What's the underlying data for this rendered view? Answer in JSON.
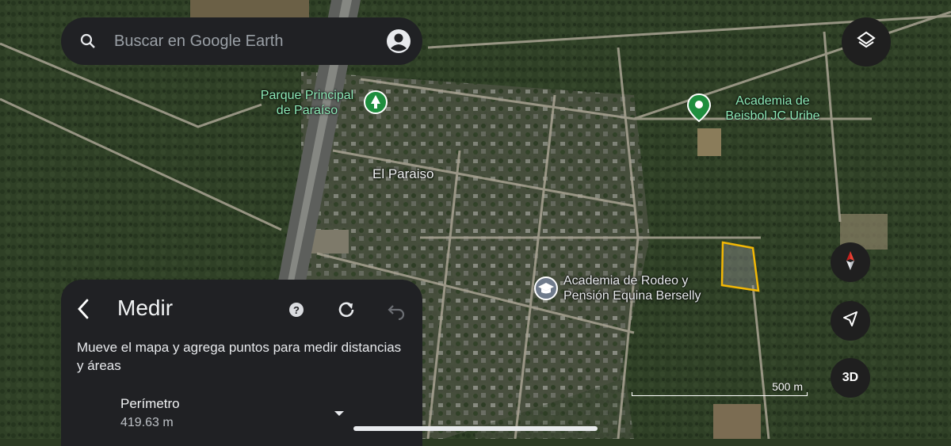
{
  "search": {
    "placeholder": "Buscar en Google Earth"
  },
  "map": {
    "places": [
      {
        "id": "parque",
        "line1": "Parque Principal",
        "line2": "de Paraíso"
      },
      {
        "id": "academia_beisbol",
        "line1": "Academia de",
        "line2": "Beisbol JC Uribe"
      },
      {
        "id": "el_paraiso",
        "line1": "El Paraiso"
      },
      {
        "id": "academia_rodeo",
        "line1": "Academia de Rodeo y",
        "line2": "Pensión Equina Berselly"
      }
    ],
    "scale_label": "500 m",
    "measured_area_color": "#f2b705"
  },
  "controls": {
    "btn_3d_label": "3D"
  },
  "measure_panel": {
    "title": "Medir",
    "description": "Mueve el mapa y agrega puntos para medir distancias y áreas",
    "perimeter_label": "Perímetro",
    "perimeter_value": "419.63 m"
  },
  "icons": [
    "search-icon",
    "account-icon",
    "layers-icon",
    "compass-icon",
    "location-arrow-icon",
    "back-arrow-icon",
    "help-icon",
    "refresh-icon",
    "undo-icon",
    "chevron-down-icon",
    "park-pin-icon",
    "place-pin-icon",
    "school-pin-icon"
  ]
}
